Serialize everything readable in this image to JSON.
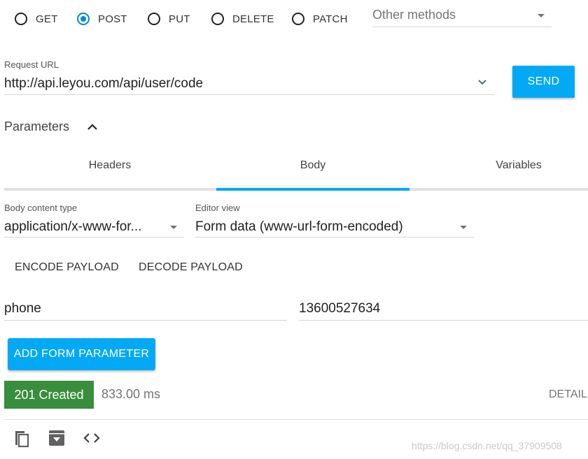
{
  "methods": {
    "options": [
      {
        "label": "GET",
        "checked": false
      },
      {
        "label": "POST",
        "checked": true
      },
      {
        "label": "PUT",
        "checked": false
      },
      {
        "label": "DELETE",
        "checked": false
      },
      {
        "label": "PATCH",
        "checked": false
      }
    ],
    "other_methods_label": "Other methods"
  },
  "request": {
    "url_label": "Request URL",
    "url_value": "http://api.leyou.com/api/user/code",
    "send_label": "SEND"
  },
  "parameters": {
    "title": "Parameters",
    "tabs": [
      {
        "label": "Headers",
        "active": false
      },
      {
        "label": "Body",
        "active": true
      },
      {
        "label": "Variables",
        "active": false
      }
    ]
  },
  "body": {
    "content_type_label": "Body content type",
    "content_type_value": "application/x-www-for...",
    "editor_view_label": "Editor view",
    "editor_view_value": "Form data (www-url-form-encoded)",
    "encode_label": "ENCODE PAYLOAD",
    "decode_label": "DECODE PAYLOAD",
    "form_param": {
      "name": "phone",
      "value": "13600527634"
    },
    "add_param_label": "ADD FORM PARAMETER"
  },
  "response": {
    "status": "201 Created",
    "time": "833.00 ms",
    "details_label": "DETAIL",
    "status_color": "#388e3c"
  },
  "watermark": "https://blog.csdn.net/qq_37909508",
  "colors": {
    "accent": "#03a9f4",
    "radio_active": "#0288d1",
    "tab_indicator": "#03a9f4"
  }
}
